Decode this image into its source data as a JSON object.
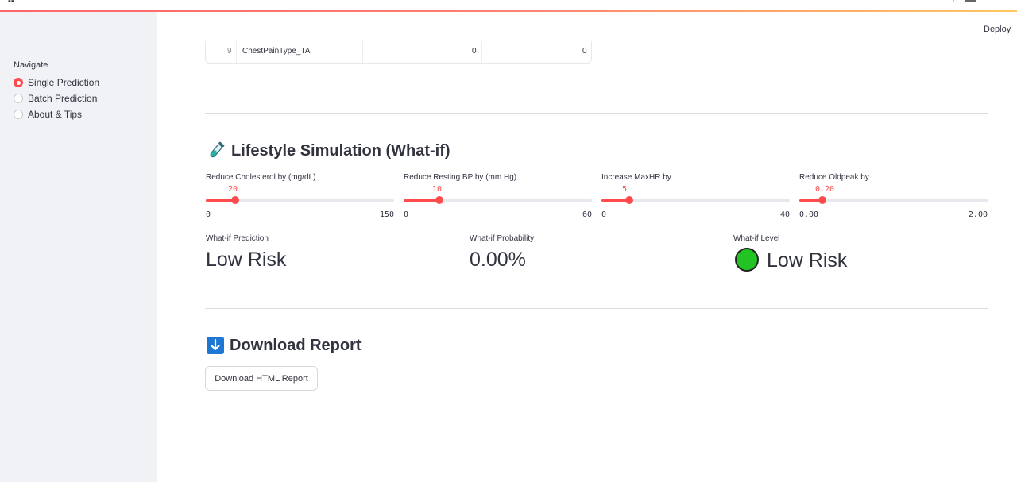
{
  "header": {
    "deploy_label": "Deploy"
  },
  "sidebar": {
    "nav_label": "Navigate",
    "items": [
      {
        "label": "Single Prediction",
        "selected": true
      },
      {
        "label": "Batch Prediction",
        "selected": false
      },
      {
        "label": "About & Tips",
        "selected": false
      }
    ]
  },
  "table_row": {
    "index": "9",
    "feature": "ChestPainType_TA",
    "col1": "0",
    "col2": "0"
  },
  "lifestyle": {
    "title": "Lifestyle Simulation (What-if)",
    "icon": "test-tube-icon",
    "sliders": [
      {
        "label": "Reduce Cholesterol by (mg/dL)",
        "value": "20",
        "min": "0",
        "max": "150",
        "fraction": 0.1333
      },
      {
        "label": "Reduce Resting BP by (mm Hg)",
        "value": "10",
        "min": "0",
        "max": "60",
        "fraction": 0.1667
      },
      {
        "label": "Increase MaxHR by",
        "value": "5",
        "min": "0",
        "max": "40",
        "fraction": 0.125
      },
      {
        "label": "Reduce Oldpeak by",
        "value": "0.20",
        "min": "0.00",
        "max": "2.00",
        "fraction": 0.1
      }
    ],
    "metrics": {
      "prediction": {
        "label": "What-if Prediction",
        "value": "Low Risk"
      },
      "probability": {
        "label": "What-if Probability",
        "value": "0.00%"
      },
      "level": {
        "label": "What-if Level",
        "value": "Low Risk",
        "color": "#22c322"
      }
    }
  },
  "download": {
    "title": "Download Report",
    "icon": "down-arrow-icon",
    "button_label": "Download HTML Report"
  },
  "colors": {
    "accent": "#ff4b4b",
    "sidebar_bg": "#f0f2f6"
  }
}
